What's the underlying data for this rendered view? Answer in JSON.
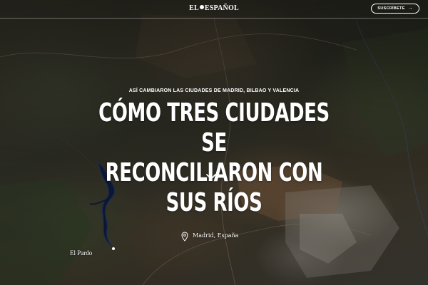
{
  "header": {
    "logo_text_left": "EL",
    "logo_text_right": "ESPAÑOL",
    "subscribe_label": "SUSCRÍBETE",
    "subscribe_arrow": "→"
  },
  "hero": {
    "kicker": "ASÍ CAMBIARON LAS CIUDADES DE MADRID, BILBAO Y VALENCIA",
    "headline_line1": "CÓMO TRES CIUDADES SE",
    "headline_line2": "RECONCILIARON CON SUS RÍOS"
  },
  "map": {
    "location_label": "Madrid, España",
    "place_label": "El Pardo"
  },
  "icons": {
    "scroll": "chevron-down-icon",
    "location": "map-pin-icon",
    "logo": "eagle-logo-icon"
  },
  "colors": {
    "text": "#ffffff",
    "reservoir": "#0d1a3a"
  }
}
